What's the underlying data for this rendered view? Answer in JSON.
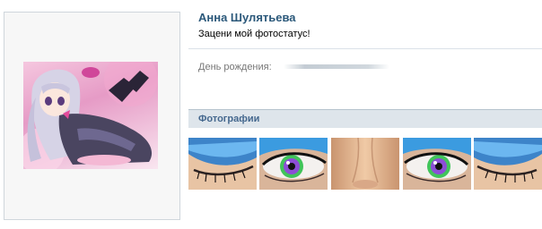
{
  "profile": {
    "name": "Анна Шулятьева",
    "status": "Зацени мой фотостатус!",
    "birthday_label": "День рождения:",
    "birthday_value_hidden": true
  },
  "photos_section": {
    "title": "Фотографии",
    "items": [
      {
        "kind": "eye-closed",
        "accent": "#3d84c9"
      },
      {
        "kind": "eye-open-rainbow",
        "accent": "#3b9be0"
      },
      {
        "kind": "nose-skin",
        "accent": "#e2b58e"
      },
      {
        "kind": "eye-open-rainbow",
        "accent": "#3b9be0"
      },
      {
        "kind": "eye-closed",
        "accent": "#3d84c9"
      }
    ]
  },
  "colors": {
    "name_link": "#2b587a",
    "section_header_bg": "#dee5eb",
    "section_title": "#45688e",
    "label_gray": "#777777"
  }
}
